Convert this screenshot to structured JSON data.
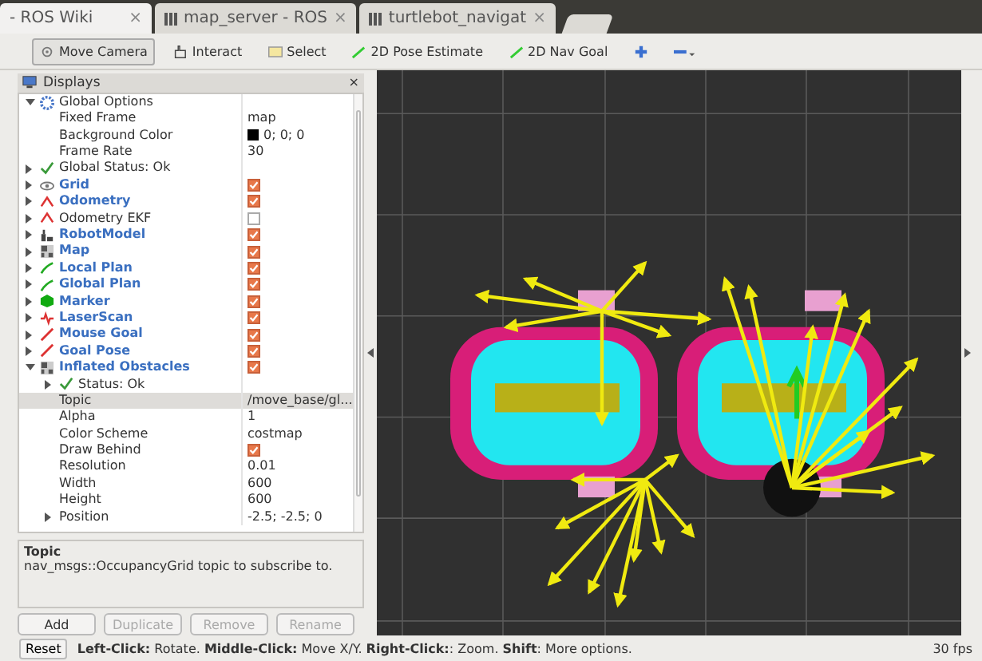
{
  "browser_tabs": [
    {
      "title": "- ROS Wiki",
      "close": "×",
      "selected": true
    },
    {
      "title": "map_server - ROS",
      "close": "×",
      "selected": false
    },
    {
      "title": "turtlebot_navigat",
      "close": "×",
      "selected": false
    }
  ],
  "toolbar": [
    {
      "kind": "camera",
      "label": "Move Camera",
      "selected": true
    },
    {
      "kind": "interact",
      "label": "Interact",
      "selected": false
    },
    {
      "kind": "select",
      "label": "Select",
      "selected": false
    },
    {
      "kind": "pose",
      "label": "2D Pose Estimate",
      "selected": false
    },
    {
      "kind": "pose",
      "label": "2D Nav Goal",
      "selected": false
    },
    {
      "kind": "plus",
      "selected": false
    },
    {
      "kind": "minus",
      "selected": false
    }
  ],
  "displays": {
    "title": "Displays",
    "close": "×",
    "items": [
      {
        "kind": "options",
        "name": "Global Options",
        "expanded": true,
        "selected": false,
        "children": [
          {
            "kind": "property",
            "name": "Fixed Frame",
            "value": "map",
            "selected": false
          },
          {
            "kind": "property",
            "name": "Background Color",
            "value": "0; 0; 0",
            "color": "#000000",
            "selected": false
          },
          {
            "kind": "property",
            "name": "Frame Rate",
            "value": "30",
            "selected": false
          }
        ]
      },
      {
        "kind": "status",
        "name": "Global Status: Ok",
        "expanded": false,
        "selected": false
      },
      {
        "kind": "grid",
        "name": "Grid",
        "expanded": false,
        "checked": true,
        "selected": false
      },
      {
        "kind": "odometry",
        "name": "Odometry",
        "expanded": false,
        "checked": true,
        "selected": false
      },
      {
        "kind": "odometry",
        "name": "Odometry EKF",
        "expanded": false,
        "checked": false,
        "selected": false
      },
      {
        "kind": "robot",
        "name": "RobotModel",
        "expanded": false,
        "checked": true,
        "selected": false
      },
      {
        "kind": "map",
        "name": "Map",
        "expanded": false,
        "checked": true,
        "selected": false
      },
      {
        "kind": "path",
        "name": "Local Plan",
        "expanded": false,
        "checked": true,
        "selected": false
      },
      {
        "kind": "path",
        "name": "Global Plan",
        "expanded": false,
        "checked": true,
        "selected": false
      },
      {
        "kind": "marker",
        "name": "Marker",
        "expanded": false,
        "checked": true,
        "selected": false
      },
      {
        "kind": "laser",
        "name": "LaserScan",
        "expanded": false,
        "checked": true,
        "selected": false
      },
      {
        "kind": "goal",
        "name": "Mouse Goal",
        "expanded": false,
        "checked": true,
        "selected": false
      },
      {
        "kind": "goal",
        "name": "Goal Pose",
        "expanded": false,
        "checked": true,
        "selected": false
      },
      {
        "kind": "map",
        "name": "Inflated Obstacles",
        "expanded": true,
        "checked": true,
        "selected": false,
        "children": [
          {
            "kind": "status",
            "name": "Status: Ok",
            "expanded": false,
            "selected": false
          },
          {
            "kind": "property",
            "name": "Topic",
            "value": "/move_base/gl...",
            "selected": true
          },
          {
            "kind": "property",
            "name": "Alpha",
            "value": "1",
            "selected": false
          },
          {
            "kind": "property",
            "name": "Color Scheme",
            "value": "costmap",
            "selected": false
          },
          {
            "kind": "checkbox",
            "name": "Draw Behind",
            "checked": true,
            "selected": false
          },
          {
            "kind": "property",
            "name": "Resolution",
            "value": "0.01",
            "selected": false
          },
          {
            "kind": "property",
            "name": "Width",
            "value": "600",
            "selected": false
          },
          {
            "kind": "property",
            "name": "Height",
            "value": "600",
            "selected": false
          },
          {
            "kind": "property",
            "name": "Position",
            "value": "-2.5; -2.5; 0",
            "expanded": false,
            "selected": false
          }
        ]
      }
    ]
  },
  "description": {
    "title": "Topic",
    "text": "nav_msgs::OccupancyGrid topic to subscribe to."
  },
  "buttons": [
    {
      "label": "Add",
      "disabled": false
    },
    {
      "label": "Duplicate",
      "disabled": true
    },
    {
      "label": "Remove",
      "disabled": true
    },
    {
      "label": "Rename",
      "disabled": true
    }
  ],
  "status_bar": {
    "reset": "Reset",
    "hint": "**Left-Click:** Rotate. **Middle-Click:** Move X/Y. **Right-Click:**: Zoom. **Shift**: More options.",
    "fps": "30 fps"
  }
}
